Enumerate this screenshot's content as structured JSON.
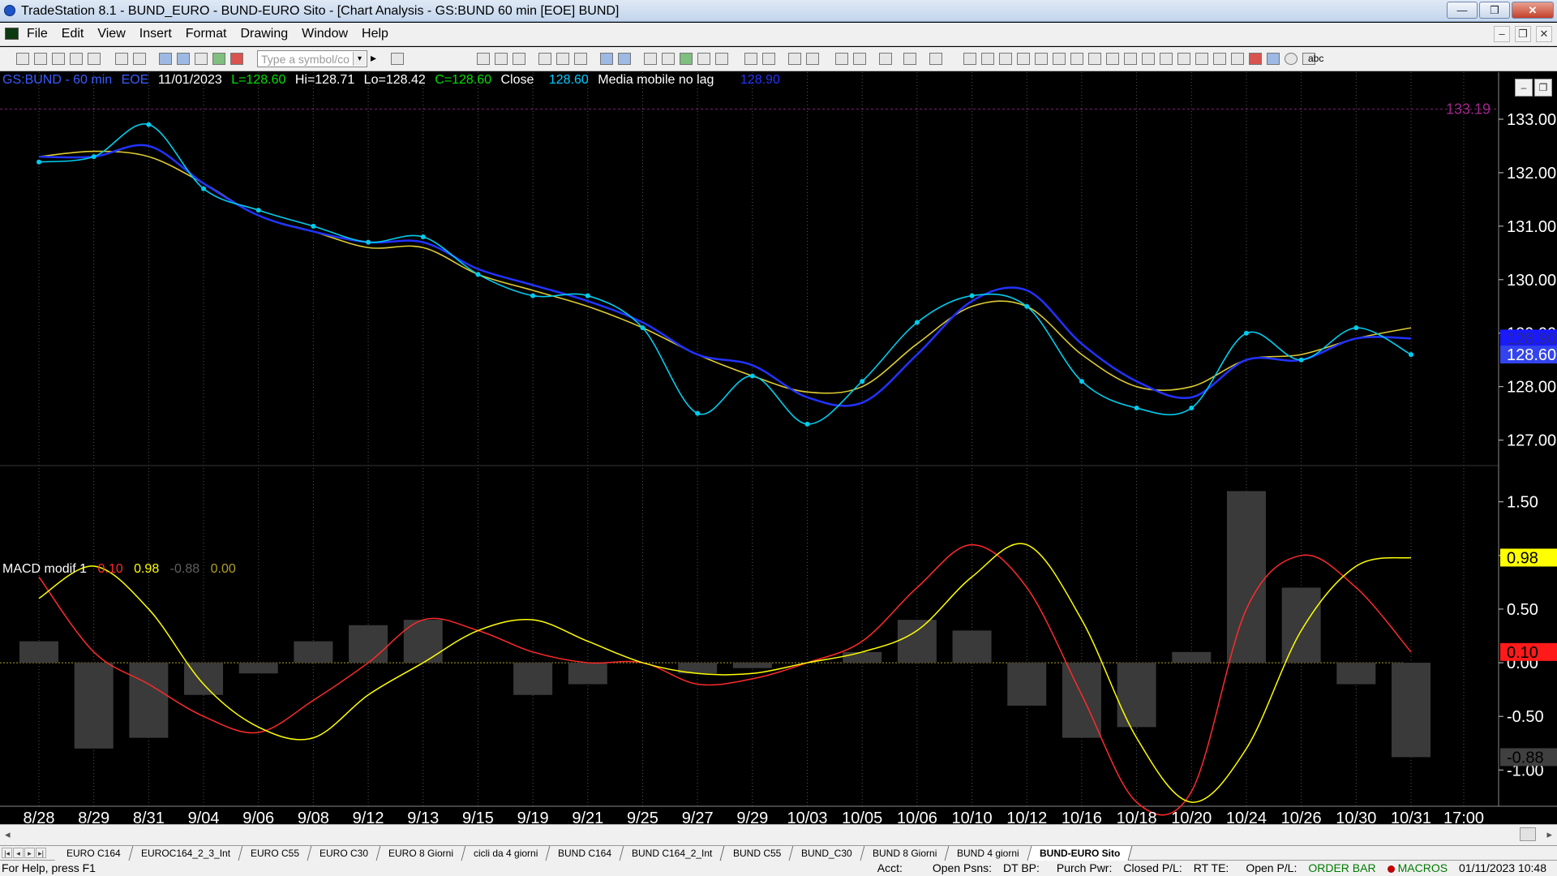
{
  "window": {
    "title": "TradeStation 8.1 - BUND_EURO - BUND-EURO Sito - [Chart Analysis - GS:BUND  60 min  [EOE] BUND]",
    "controls": [
      "—",
      "❐",
      "✕"
    ]
  },
  "menu": {
    "items": [
      "File",
      "Edit",
      "View",
      "Insert",
      "Format",
      "Drawing",
      "Window",
      "Help"
    ],
    "mdi_controls": [
      "–",
      "❐",
      "✕"
    ]
  },
  "toolbar": {
    "symbol_placeholder": "Type a symbol/co",
    "dropdown_glyph": "▾",
    "play_glyph": "▸",
    "text_tool_label": "abc"
  },
  "chart_header": {
    "symbol": "GS:BUND - 60 min",
    "session": "EOE",
    "date": "11/01/2023",
    "low_open": "L=128.60",
    "high": "Hi=128.71",
    "low": "Lo=128.42",
    "close": "C=128.60",
    "study1_name": "Close",
    "study1_value": "128.60",
    "study2_name": "Media mobile no lag",
    "study2_value": "128.90",
    "colors": {
      "symbol": "#3a5cff",
      "close": "#00e000",
      "value": "#00ccff",
      "text": "#ffffff"
    }
  },
  "macd_header": {
    "name": "MACD modif 1",
    "v1": "0.10",
    "v2": "0.98",
    "v3": "-0.88",
    "v4": "0.00",
    "colors": {
      "v1": "#ff2a2a",
      "v2": "#ffff00",
      "v3": "#606060",
      "v4": "#b0a020"
    }
  },
  "price_axis": {
    "ticks": [
      "133.00",
      "132.00",
      "131.00",
      "130.00",
      "129.00",
      "128.00",
      "127.00"
    ],
    "high_marker": "133.19",
    "last_blue_label": "128.90",
    "last_close_label": "128.60"
  },
  "macd_axis": {
    "ticks": [
      "1.50",
      "1.00",
      "0.50",
      "0.00",
      "-0.50",
      "-1.00"
    ],
    "labels": {
      "signal": "0.98",
      "macd": "0.10",
      "zero": "0.00",
      "hist": "-0.88"
    }
  },
  "time_axis": {
    "labels": [
      "8/28",
      "8/29",
      "8/31",
      "9/04",
      "9/06",
      "9/08",
      "9/12",
      "9/13",
      "9/15",
      "9/19",
      "9/21",
      "9/25",
      "9/27",
      "9/29",
      "10/03",
      "10/05",
      "10/06",
      "10/10",
      "10/12",
      "10/16",
      "10/18",
      "10/20",
      "10/24",
      "10/26",
      "10/30",
      "10/31",
      "17:00"
    ]
  },
  "chart_data": [
    {
      "type": "line",
      "title": "GS:BUND - 60 min",
      "ylim": [
        126.6,
        133.5
      ],
      "xlabel": "",
      "ylabel": "",
      "grid": "vertical dotted",
      "x": [
        "8/28",
        "8/29",
        "8/31",
        "9/04",
        "9/06",
        "9/08",
        "9/12",
        "9/13",
        "9/15",
        "9/19",
        "9/21",
        "9/25",
        "9/27",
        "9/29",
        "10/03",
        "10/05",
        "10/06",
        "10/10",
        "10/12",
        "10/16",
        "10/18",
        "10/20",
        "10/24",
        "10/26",
        "10/30",
        "10/31"
      ],
      "series": [
        {
          "name": "Close",
          "color": "#00ccee",
          "values": [
            132.2,
            132.3,
            132.9,
            131.7,
            131.3,
            131.0,
            130.7,
            130.8,
            130.1,
            129.7,
            129.7,
            129.1,
            127.5,
            128.2,
            127.3,
            128.1,
            129.2,
            129.7,
            129.5,
            128.1,
            127.6,
            127.6,
            129.0,
            128.5,
            129.1,
            128.6
          ]
        },
        {
          "name": "Media mobile no lag",
          "color": "#2233ff",
          "values": [
            132.3,
            132.3,
            132.5,
            131.8,
            131.2,
            130.9,
            130.7,
            130.7,
            130.2,
            129.9,
            129.6,
            129.2,
            128.6,
            128.4,
            127.8,
            127.7,
            128.6,
            129.6,
            129.8,
            128.8,
            128.1,
            127.8,
            128.5,
            128.5,
            128.9,
            128.9
          ]
        },
        {
          "name": "",
          "color": "#ddcc33",
          "values": [
            132.3,
            132.4,
            132.3,
            131.8,
            131.2,
            130.9,
            130.6,
            130.6,
            130.1,
            129.8,
            129.5,
            129.1,
            128.6,
            128.2,
            127.9,
            128.0,
            128.8,
            129.5,
            129.5,
            128.6,
            128.0,
            128.0,
            128.5,
            128.6,
            128.9,
            129.1
          ]
        }
      ]
    },
    {
      "type": "line",
      "title": "MACD modif 1",
      "ylim": [
        -1.3,
        1.8
      ],
      "x": [
        "8/28",
        "8/29",
        "8/31",
        "9/04",
        "9/06",
        "9/08",
        "9/12",
        "9/13",
        "9/15",
        "9/19",
        "9/21",
        "9/25",
        "9/27",
        "9/29",
        "10/03",
        "10/05",
        "10/06",
        "10/10",
        "10/12",
        "10/16",
        "10/18",
        "10/20",
        "10/24",
        "10/26",
        "10/30",
        "10/31"
      ],
      "series": [
        {
          "name": "",
          "color": "#ff2a2a",
          "values": [
            0.8,
            0.1,
            -0.2,
            -0.5,
            -0.65,
            -0.35,
            0.0,
            0.4,
            0.3,
            0.1,
            0.0,
            0.0,
            -0.2,
            -0.15,
            0.0,
            0.2,
            0.7,
            1.1,
            0.7,
            -0.3,
            -1.3,
            -1.2,
            0.5,
            1.0,
            0.7,
            0.1
          ]
        },
        {
          "name": "",
          "color": "#ffff00",
          "values": [
            0.6,
            0.9,
            0.5,
            -0.2,
            -0.6,
            -0.7,
            -0.3,
            0.0,
            0.3,
            0.4,
            0.2,
            0.0,
            -0.1,
            -0.1,
            0.0,
            0.1,
            0.3,
            0.8,
            1.1,
            0.4,
            -0.7,
            -1.3,
            -0.8,
            0.3,
            0.9,
            0.98
          ]
        },
        {
          "name": "",
          "color": "#707070",
          "style": "histogram",
          "values": [
            0.2,
            -0.8,
            -0.7,
            -0.3,
            -0.1,
            0.2,
            0.35,
            0.4,
            0.0,
            -0.3,
            -0.2,
            0.0,
            -0.1,
            -0.05,
            0.0,
            0.1,
            0.4,
            0.3,
            -0.4,
            -0.7,
            -0.6,
            0.1,
            1.6,
            0.7,
            -0.2,
            -0.88
          ]
        }
      ]
    }
  ],
  "sheet_tabs": [
    "EURO C164",
    "EUROC164_2_3_Int",
    "EURO C55",
    "EURO C30",
    "EURO 8 Giorni",
    "cicli da 4 giorni",
    "BUND C164",
    "BUND C164_2_Int",
    "BUND C55",
    "BUND_C30",
    "BUND 8 Giorni",
    "BUND 4 giorni",
    "BUND-EURO Sito"
  ],
  "active_tab": "BUND-EURO Sito",
  "statusbar": {
    "help": "For Help, press F1",
    "acct": "Acct:",
    "open_psns": "Open Psns:",
    "dt_bp": "DT BP:",
    "purch_pwr": "Purch Pwr:",
    "closed_pl": "Closed P/L:",
    "rt_te": "RT TE:",
    "open_pl": "Open P/L:",
    "order_bar": "ORDER BAR",
    "macros": "MACROS",
    "datetime": "01/11/2023 10:48"
  }
}
